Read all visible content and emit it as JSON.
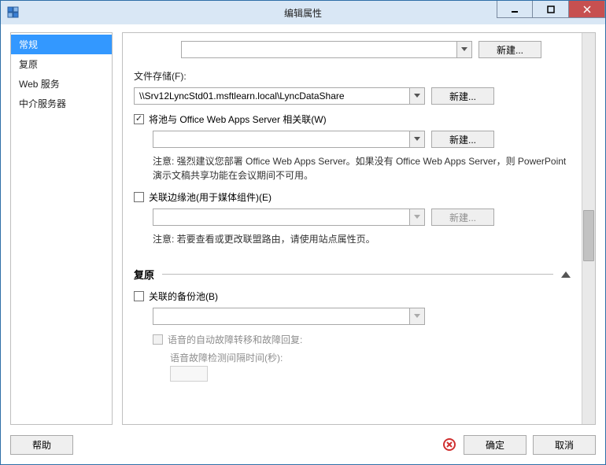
{
  "window": {
    "title": "编辑属性"
  },
  "sidebar": {
    "items": [
      {
        "label": "常规"
      },
      {
        "label": "复原"
      },
      {
        "label": "Web 服务"
      },
      {
        "label": "中介服务器"
      }
    ]
  },
  "main": {
    "top_combo_value": "",
    "top_new_label": "新建...",
    "file_store_label": "文件存储(F):",
    "file_store_value": "\\\\Srv12LyncStd01.msftlearn.local\\LyncDataShare",
    "file_store_new_label": "新建...",
    "owa_checkbox_label": "将池与 Office Web Apps Server 相关联(W)",
    "owa_checked": true,
    "owa_combo_value": "",
    "owa_new_label": "新建...",
    "owa_note": "注意: 强烈建议您部署 Office Web Apps Server。如果没有 Office Web Apps Server，则 PowerPoint 演示文稿共享功能在会议期间不可用。",
    "edge_checkbox_label": "关联边缘池(用于媒体组件)(E)",
    "edge_checked": false,
    "edge_combo_value": "",
    "edge_new_label": "新建...",
    "edge_note": "注意: 若要查看或更改联盟路由，请使用站点属性页。",
    "resiliency_header": "复原",
    "backup_checkbox_label": "关联的备份池(B)",
    "backup_checked": false,
    "backup_combo_value": "",
    "voice_fail_label": "语音的自动故障转移和故障回复:",
    "voice_fail_checked": false,
    "voice_interval_label": "语音故障检测间隔时间(秒):",
    "voice_interval_value": ""
  },
  "footer": {
    "help_label": "帮助",
    "ok_label": "确定",
    "cancel_label": "取消"
  }
}
